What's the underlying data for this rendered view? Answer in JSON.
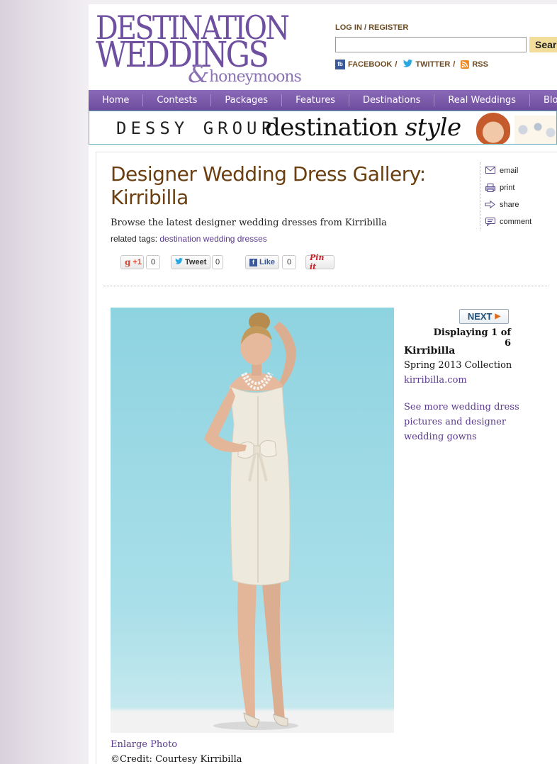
{
  "header": {
    "logo_line1": "DESTINATION",
    "logo_line2": "WEDDINGS",
    "logo_amp": "&",
    "logo_sub": "honeymoons",
    "login_label": "LOG IN",
    "register_label": "REGISTER",
    "auth_sep": " / ",
    "search": {
      "value": "",
      "placeholder": "",
      "button_label": "Search"
    },
    "social": [
      {
        "label": "FACEBOOK",
        "icon": "facebook-icon",
        "sep": " /"
      },
      {
        "label": "TWITTER",
        "icon": "twitter-icon",
        "sep": " /"
      },
      {
        "label": "RSS",
        "icon": "rss-icon",
        "sep": ""
      }
    ],
    "fb_glyph": "fb"
  },
  "nav": {
    "items": [
      "Home",
      "Contests",
      "Packages",
      "Features",
      "Destinations",
      "Real Weddings",
      "Blog"
    ]
  },
  "banner": {
    "brand": "DESSY GROUP",
    "tagline_main": "destination ",
    "tagline_italic": "style"
  },
  "article": {
    "title": "Designer Wedding Dress Gallery: Kirribilla",
    "lede": "Browse the latest designer wedding dresses from Kirribilla",
    "tags_label": "related tags: ",
    "tags": [
      "destination wedding dresses"
    ]
  },
  "tools": [
    {
      "label": "email",
      "icon": "envelope-icon"
    },
    {
      "label": "print",
      "icon": "printer-icon"
    },
    {
      "label": "share",
      "icon": "share-arrow-icon"
    },
    {
      "label": "comment",
      "icon": "comment-icon"
    }
  ],
  "share_buttons": {
    "gplus": {
      "label": "+1",
      "count": "0"
    },
    "tweet": {
      "label": "Tweet",
      "count": "0"
    },
    "like": {
      "label": "Like",
      "count": "0"
    },
    "pin": {
      "label": "Pin it"
    }
  },
  "gallery": {
    "next_label": "NEXT",
    "displaying": "Displaying 1 of 6",
    "brand": "Kirribilla",
    "collection": "Spring 2013 Collection",
    "site": "kirribilla.com",
    "more_link": "See more wedding dress pictures and designer wedding gowns",
    "enlarge_label": "Enlarge Photo",
    "credit": "©Credit: Courtesy Kirribilla"
  },
  "colors": {
    "nav_purple": "#7a5aab",
    "title_brown": "#6b3f10",
    "link_purple": "#5b3a8f",
    "photo_bg": "#9dd9e5"
  }
}
